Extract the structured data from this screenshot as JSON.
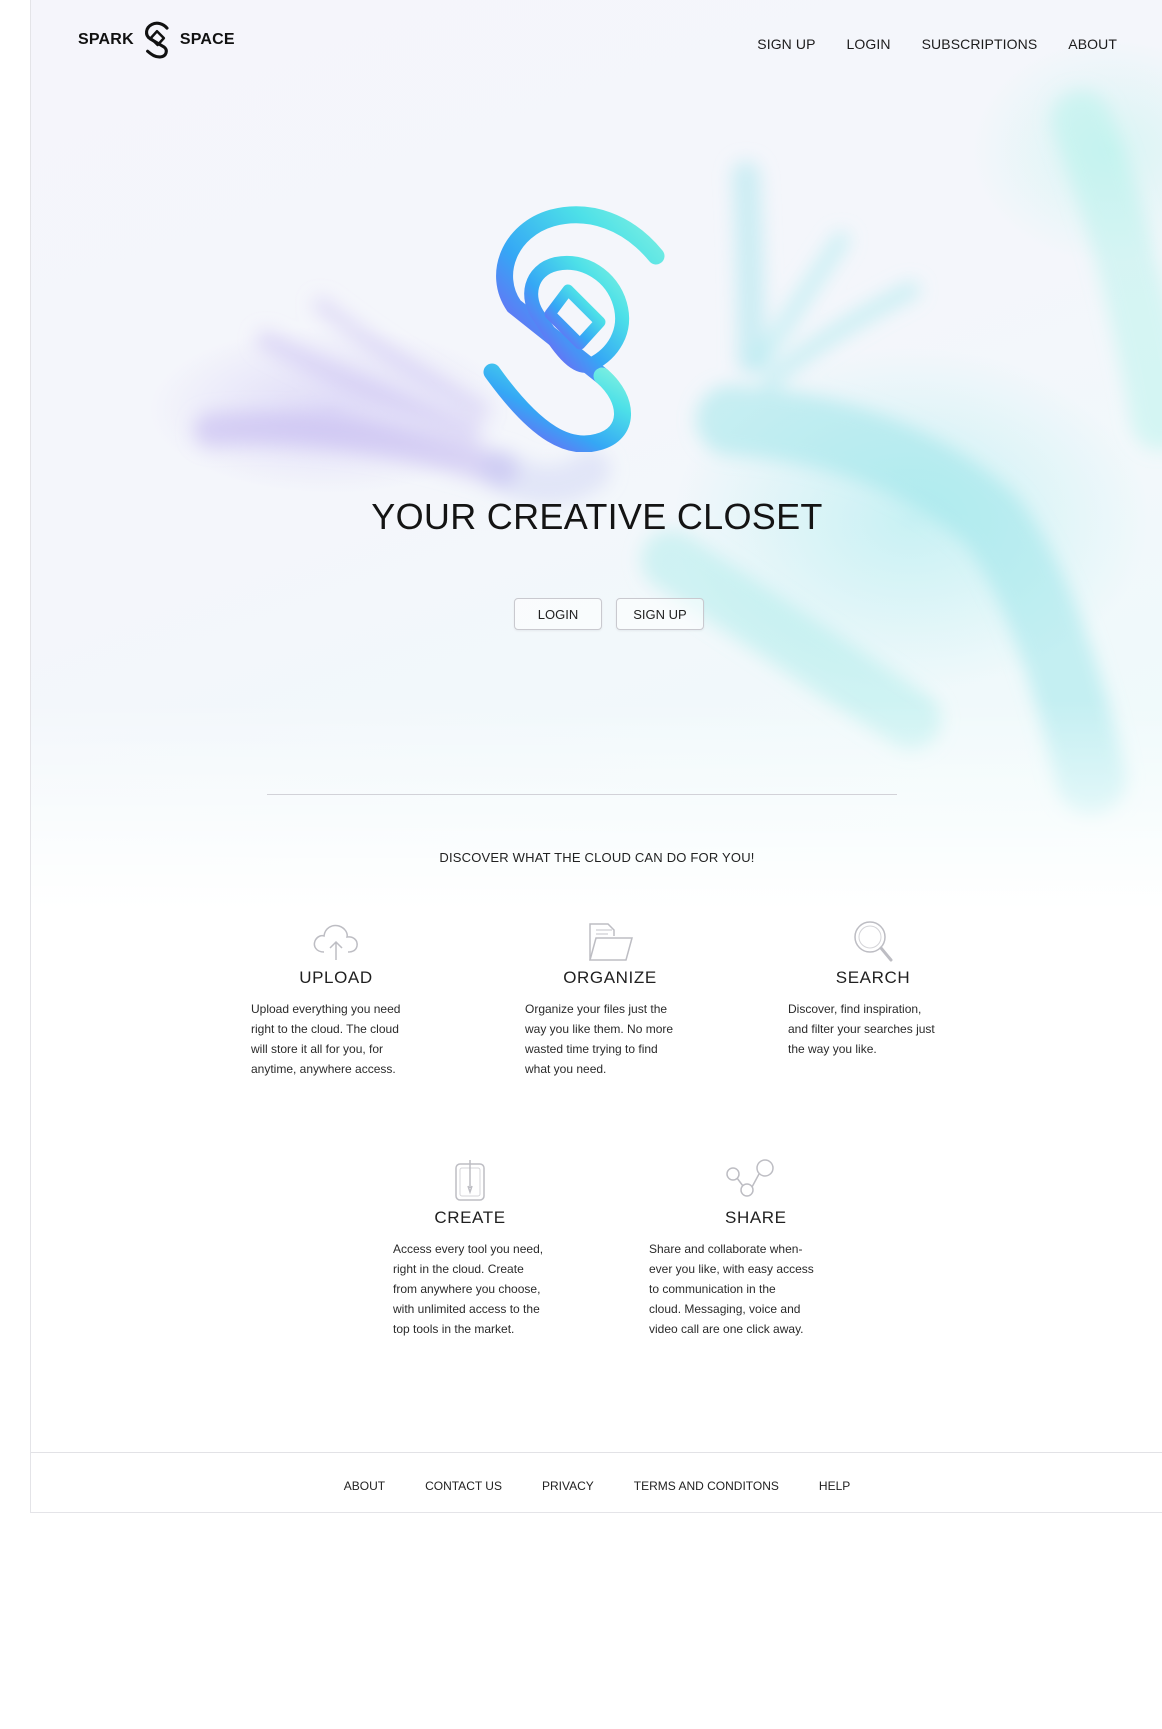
{
  "brand": {
    "left_word": "SPARK",
    "right_word": "SPACE",
    "logo_icon": "s-loop-logo-icon"
  },
  "nav": {
    "items": [
      "SIGN UP",
      "LOGIN",
      "SUBSCRIPTIONS",
      "ABOUT"
    ]
  },
  "hero": {
    "title": "YOUR CREATIVE CLOSET",
    "login_label": "LOGIN",
    "signup_label": "SIGN UP",
    "logo_gradient": [
      "#8a4df5",
      "#35a7f5",
      "#4de0e8",
      "#7ff0e0"
    ]
  },
  "discover": {
    "heading": "DISCOVER WHAT THE CLOUD CAN DO FOR YOU!"
  },
  "features": [
    {
      "icon": "cloud-upload-icon",
      "title": "UPLOAD",
      "lines": [
        "Upload everything you need",
        "right to the cloud. The cloud",
        "will store it all for you, for",
        "anytime, anywhere access."
      ]
    },
    {
      "icon": "folder-icon",
      "title": "ORGANIZE",
      "lines": [
        "Organize your files just the",
        "way you like them. No more",
        "wasted time trying to find",
        "what you need."
      ]
    },
    {
      "icon": "magnifier-icon",
      "title": "SEARCH",
      "lines": [
        "Discover, find inspiration,",
        "and filter your searches just",
        "the way you like."
      ]
    },
    {
      "icon": "pen-tool-icon",
      "title": "CREATE",
      "lines": [
        "Access every tool you need,",
        "right in the cloud. Create",
        "from anywhere you choose,",
        "with unlimited access to the",
        "top tools in the market."
      ]
    },
    {
      "icon": "share-nodes-icon",
      "title": "SHARE",
      "lines": [
        "Share and collaborate when-",
        "ever you like, with easy access",
        "to communication in the",
        "cloud. Messaging, voice and",
        "video call are one click away."
      ]
    }
  ],
  "footer": {
    "items": [
      "ABOUT",
      "CONTACT US",
      "PRIVACY",
      "TERMS AND CONDITONS",
      "HELP"
    ]
  }
}
